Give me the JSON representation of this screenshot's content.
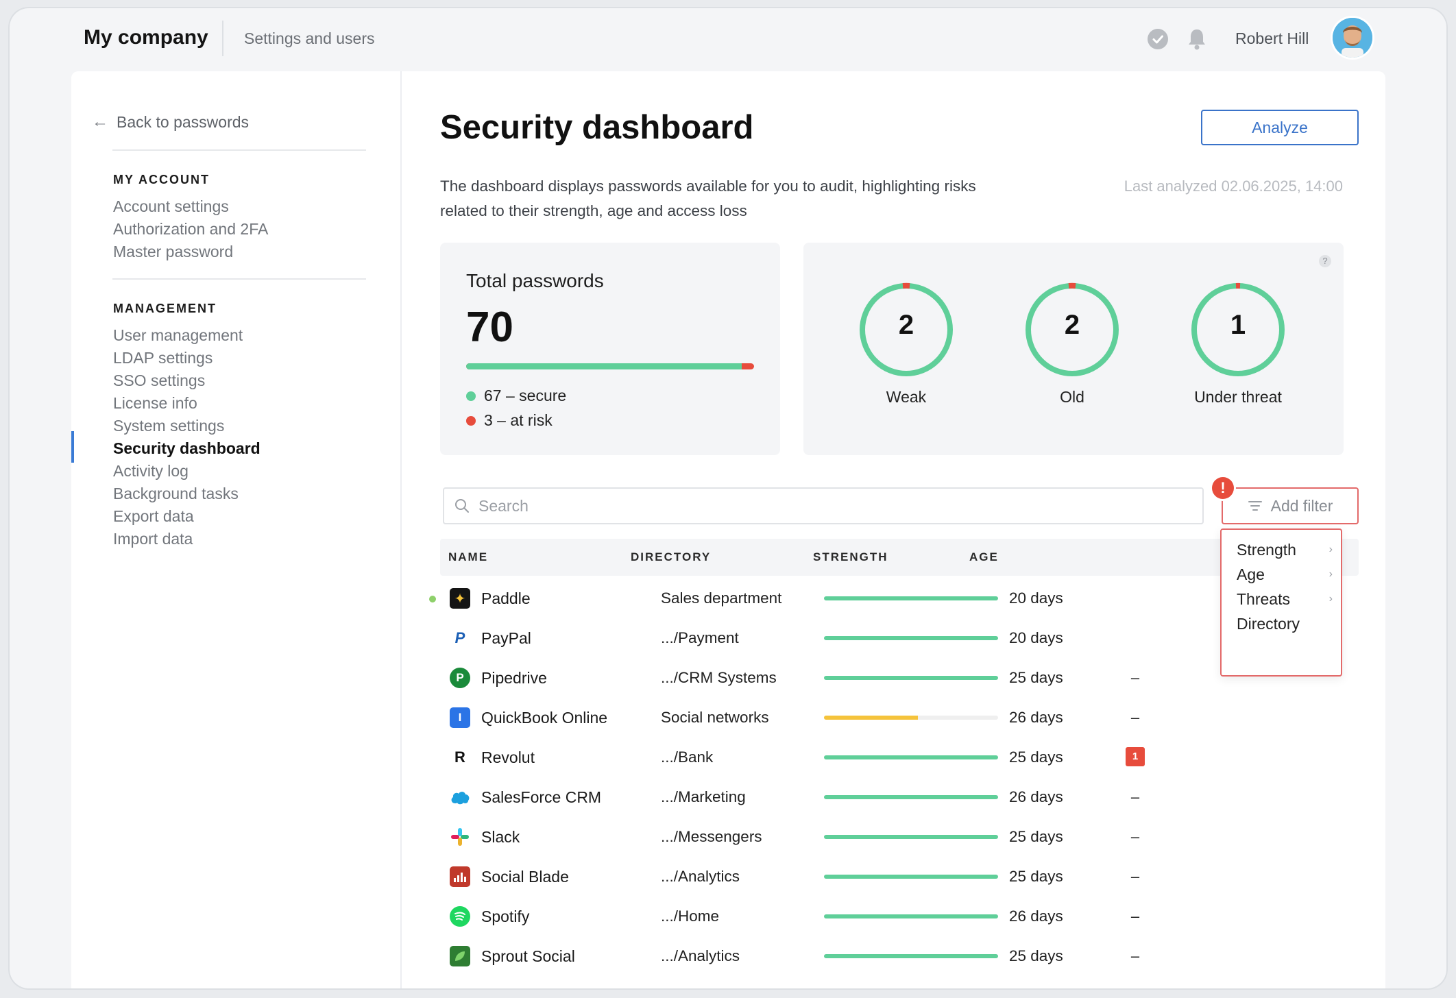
{
  "topbar": {
    "brand": "My company",
    "crumb": "Settings and users",
    "user_name": "Robert Hill"
  },
  "sidebar": {
    "back_label": "Back to passwords",
    "my_account_heading": "MY ACCOUNT",
    "my_account_items": [
      "Account settings",
      "Authorization and 2FA",
      "Master password"
    ],
    "management_heading": "MANAGEMENT",
    "management_items": [
      "User management",
      "LDAP settings",
      "SSO settings",
      "License info",
      "System settings",
      "Security dashboard",
      "Activity log",
      "Background tasks",
      "Export data",
      "Import data"
    ],
    "active_item": "Security dashboard"
  },
  "main": {
    "title": "Security dashboard",
    "description": "The dashboard displays passwords available for you to audit, highlighting risks related to their strength, age and access loss",
    "analyze_label": "Analyze",
    "last_analyzed": "Last analyzed 02.06.2025, 14:00",
    "total": {
      "label": "Total passwords",
      "value": "70",
      "secure_text": "67 – secure",
      "risk_text": "3 – at risk",
      "secure_fraction": 0.957
    },
    "help_label": "?",
    "stats": [
      {
        "value": "2",
        "label": "Weak"
      },
      {
        "value": "2",
        "label": "Old"
      },
      {
        "value": "1",
        "label": "Under threat"
      }
    ],
    "search_placeholder": "Search",
    "add_filter_label": "Add filter",
    "alert_mark": "!",
    "columns": [
      "NAME",
      "DIRECTORY",
      "STRENGTH",
      "AGE"
    ],
    "rows": [
      {
        "name": "Paddle",
        "directory": "Sales department",
        "strength": 1.0,
        "age": "20 days",
        "threats": "",
        "icon": "paddle-icon",
        "new": true
      },
      {
        "name": "PayPal",
        "directory": ".../Payment",
        "strength": 1.0,
        "age": "20 days",
        "threats": "",
        "icon": "paypal-icon"
      },
      {
        "name": "Pipedrive",
        "directory": ".../CRM Systems",
        "strength": 1.0,
        "age": "25 days",
        "threats": "–",
        "icon": "pipedrive-icon"
      },
      {
        "name": "QuickBook Online",
        "directory": "Social networks",
        "strength": 0.54,
        "age": "26 days",
        "threats": "–",
        "icon": "quickbook-icon"
      },
      {
        "name": "Revolut",
        "directory": ".../Bank",
        "strength": 1.0,
        "age": "25 days",
        "threats": "1",
        "icon": "revolut-icon"
      },
      {
        "name": "SalesForce CRM",
        "directory": ".../Marketing",
        "strength": 1.0,
        "age": "26 days",
        "threats": "–",
        "icon": "salesforce-icon"
      },
      {
        "name": "Slack",
        "directory": ".../Messengers",
        "strength": 1.0,
        "age": "25 days",
        "threats": "–",
        "icon": "slack-icon"
      },
      {
        "name": "Social Blade",
        "directory": ".../Analytics",
        "strength": 1.0,
        "age": "25 days",
        "threats": "–",
        "icon": "socialblade-icon"
      },
      {
        "name": "Spotify",
        "directory": ".../Home",
        "strength": 1.0,
        "age": "26 days",
        "threats": "–",
        "icon": "spotify-icon"
      },
      {
        "name": "Sprout Social",
        "directory": ".../Analytics",
        "strength": 1.0,
        "age": "25 days",
        "threats": "–",
        "icon": "sproutsocial-icon"
      }
    ],
    "filter_menu": [
      {
        "label": "Strength",
        "submenu": true
      },
      {
        "label": "Age",
        "submenu": true
      },
      {
        "label": "Threats",
        "submenu": true
      },
      {
        "label": "Directory",
        "submenu": false
      }
    ]
  },
  "colors": {
    "accent": "#3a73c9",
    "secure": "#5fcf99",
    "risk": "#e74c3c",
    "medium": "#f5c33b"
  }
}
